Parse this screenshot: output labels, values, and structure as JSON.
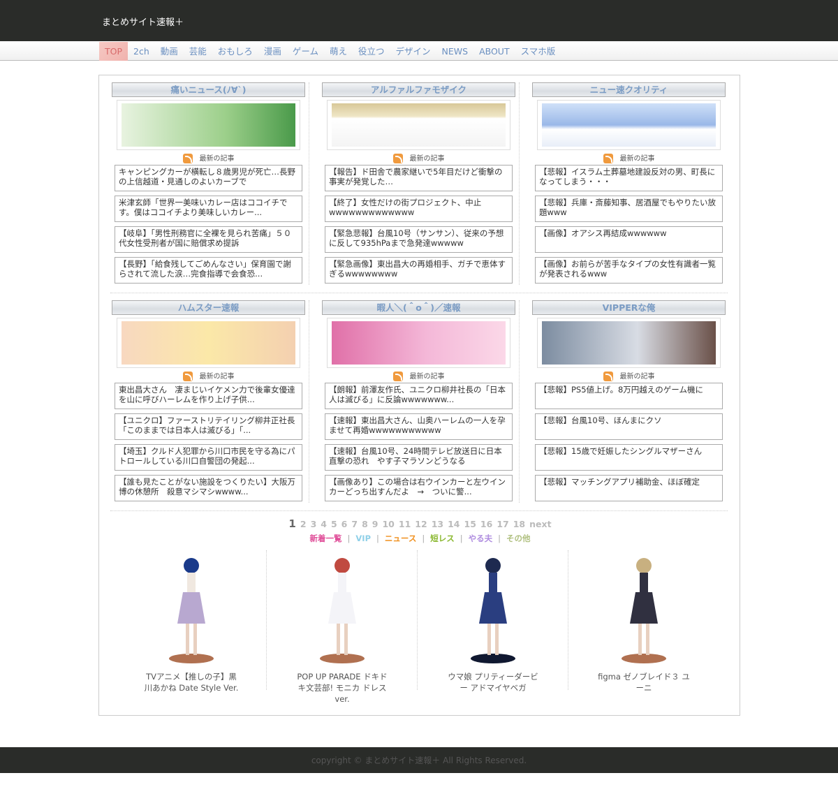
{
  "site_title": "まとめサイト速報＋",
  "nav": [
    "TOP",
    "2ch",
    "動画",
    "芸能",
    "おもしろ",
    "漫画",
    "ゲーム",
    "萌え",
    "役立つ",
    "デザイン",
    "NEWS",
    "ABOUT",
    "スマホ版"
  ],
  "rss_label": "最新の記事",
  "blogs": [
    {
      "name": "痛いニュース(ﾉ∀`)",
      "items": [
        "キャンピングカーが横転し８歳男児が死亡…長野の上信越道・見通しのよいカーブで",
        "米津玄師「世界一美味いカレー店はココイチです。僕はココイチより美味しいカレー...",
        "【岐阜】「男性刑務官に全裸を見られ苦痛」５０代女性受刑者が国に賠償求め提訴",
        "【長野】「給食残してごめんなさい」保育園で謝らされて流した涙…完食指導で会食恐..."
      ]
    },
    {
      "name": "アルファルファモザイク",
      "items": [
        "【報告】ド田舎で農家継いで5年目だけど衝撃の事実が発覚した…",
        "【終了】女性だけの街プロジェクト、中止wwwwwwwwwwwww",
        "【緊急悲報】台風10号（サンサン）、従来の予想に反して935hPaまで急発達wwwww",
        "【緊急画像】東出昌大の再婚相手、ガチで恵体すぎるwwwwwwww"
      ]
    },
    {
      "name": "ニュー速クオリティ",
      "items": [
        "【悲報】イスラム土葬墓地建設反対の男、町長になってしまう・・・",
        "【悲報】兵庫・斎藤知事、居酒屋でもやりたい放題www",
        "【画像】オアシス再結成wwwwww",
        "【画像】お前らが苦手なタイプの女性有識者一覧が発表されるwww"
      ]
    },
    {
      "name": "ハムスター速報",
      "items": [
        "東出昌大さん　凄まじいイケメン力で後輩女優達を山に呼びハーレムを作り上げ子供...",
        "【ユニクロ】ファーストリテイリング柳井正社長「このままでは日本人は滅びる」「...",
        "【埼玉】クルド人犯罪から川口市民を守る為にパトロールしている川口自警団の発起...",
        "【誰も見たことがない施設をつくりたい】大阪万博の休憩所　殺意マシマシwwww..."
      ]
    },
    {
      "name": "暇人＼(＾o＾)／速報",
      "items": [
        "【朗報】前澤友作氏、ユニクロ柳井社長の「日本人は滅びる」に反論wwwwwww...",
        "【速報】東出昌大さん、山奥ハーレムの一人を孕ませて再婚wwwwwwwwwww",
        "【速報】台風10号、24時間テレビ放送日に日本直撃の恐れ　やす子マラソンどうなる",
        "【画像あり】この場合は右ウインカーと左ウインカーどっち出すんだよ　→　ついに警..."
      ]
    },
    {
      "name": "VIPPERな俺",
      "items": [
        "【悲報】PS5値上げ。8万円越えのゲーム機に",
        "【悲報】台風10号、ほんまにクソ",
        "【悲報】15歳で妊娠したシングルマザーさん",
        "【悲報】マッチングアプリ補助金、ほぼ確定"
      ]
    }
  ],
  "pagination": {
    "current": "1",
    "pages": [
      "2",
      "3",
      "4",
      "5",
      "6",
      "7",
      "8",
      "9",
      "10",
      "11",
      "12",
      "13",
      "14",
      "15",
      "16",
      "17",
      "18"
    ],
    "next": "next"
  },
  "categories": [
    {
      "label": "新着一覧",
      "color": "#e0509a"
    },
    {
      "label": "VIP",
      "color": "#8fd0e8"
    },
    {
      "label": "ニュース",
      "color": "#f0901e"
    },
    {
      "label": "短レス",
      "color": "#8ab830"
    },
    {
      "label": "やる夫",
      "color": "#b08ee0"
    },
    {
      "label": "その他",
      "color": "#b0c080"
    }
  ],
  "figures": [
    "TVアニメ【推しの子】黒川あかね Date Style Ver.",
    "POP UP PARADE ドキドキ文芸部! モニカ ドレスver.",
    "ウマ娘 プリティーダービー アドマイヤベガ",
    "figma ゼノブレイド３ ユーニ"
  ],
  "footer": "copyright © まとめサイト速報＋ All Rights Reserved."
}
